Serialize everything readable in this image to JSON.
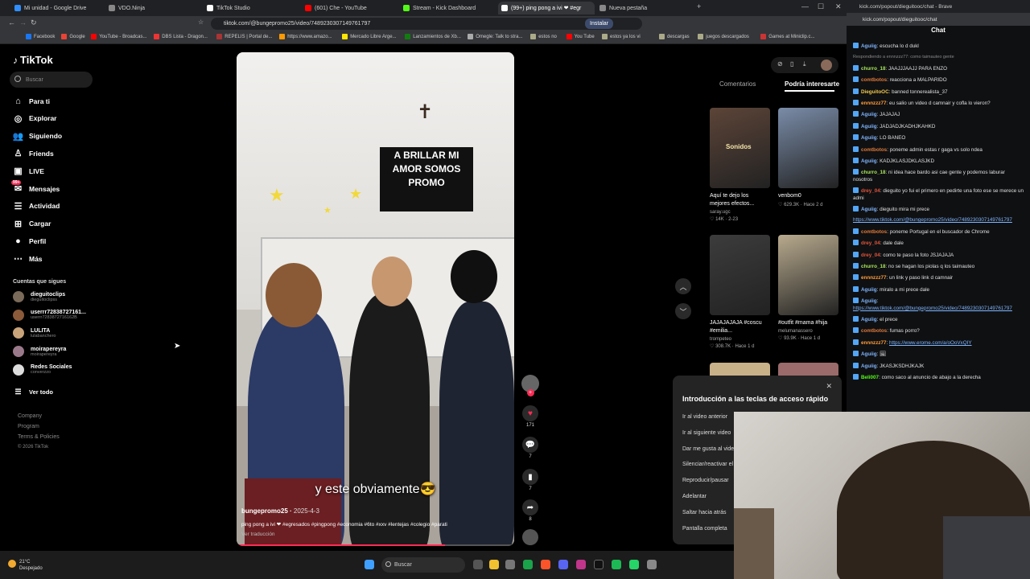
{
  "browser": {
    "tabs": [
      {
        "label": "Mi unidad - Google Drive",
        "color": "#2f8fff"
      },
      {
        "label": "VDO.Ninja",
        "color": "#888888"
      },
      {
        "label": "TikTok Studio",
        "color": "#ffffff"
      },
      {
        "label": "(601) Che - YouTube",
        "color": "#ff0000"
      },
      {
        "label": "Stream - Kick Dashboard",
        "color": "#53fc18"
      },
      {
        "label": "(99+) ping pong a ivi ❤ #egr",
        "color": "#ffffff"
      },
      {
        "label": "Nueva pestaña",
        "color": "#888888"
      }
    ],
    "url": "tiktok.com/@bungepromo25/video/7489230307149761797",
    "install_label": "Instalar",
    "bookmarks": [
      "Facebook",
      "Google",
      "YouTube - Broadcas...",
      "DBS Lista - Dragon...",
      "REPELIS | Portal de...",
      "https://www.amazo...",
      "Mercado Libre Arge...",
      "Lanzamientos de Xb...",
      "Omegle: Talk to stra...",
      "estos no",
      "You Tube",
      "estos ya los vi",
      "descargas",
      "juegos descargados",
      "Games at Miniclip.c..."
    ]
  },
  "tiktok": {
    "logo": "TikTok",
    "search_placeholder": "Buscar",
    "nav": [
      {
        "label": "Para ti",
        "icon": "⌂"
      },
      {
        "label": "Explorar",
        "icon": "◎"
      },
      {
        "label": "Siguiendo",
        "icon": "👥"
      },
      {
        "label": "Friends",
        "icon": "♙"
      },
      {
        "label": "LIVE",
        "icon": "▣"
      },
      {
        "label": "Mensajes",
        "icon": "✉"
      },
      {
        "label": "Actividad",
        "icon": "☰"
      },
      {
        "label": "Cargar",
        "icon": "⊞"
      },
      {
        "label": "Perfil",
        "icon": "●"
      },
      {
        "label": "Más",
        "icon": "⋯"
      }
    ],
    "messages_badge": "99+",
    "following_title": "Cuentas que sigues",
    "following": [
      {
        "name": "dieguitoclips",
        "handle": "dieguitoclipss"
      },
      {
        "name": "userrr72838727161...",
        "handle": "userrr7283872716162B"
      },
      {
        "name": "LULITA",
        "handle": "lulabanchero"
      },
      {
        "name": "moirapereyra",
        "handle": "moirapereyra"
      },
      {
        "name": "Redes Sociales",
        "handle": "converzzo"
      }
    ],
    "see_all": "Ver todo",
    "footer": [
      "Company",
      "Program",
      "Terms & Policies",
      "© 2026 TikTok"
    ]
  },
  "video": {
    "caption": "y este obviamente😎",
    "author": "bungepromo25",
    "date": "2025-4-3",
    "description": "ping pong a ivi ❤ #egresados #pingpong #economia #6to #xxv #lentejas #colegio #parati",
    "translate": "Ver traducción",
    "banner_text": "A BRILLAR MI AMOR SOMOS PROMO",
    "progress": 0.75,
    "actions": [
      {
        "name": "like",
        "icon": "♥",
        "count": "171"
      },
      {
        "name": "comment",
        "icon": "💬",
        "count": "7"
      },
      {
        "name": "save",
        "icon": "▮",
        "count": "7"
      },
      {
        "name": "share",
        "icon": "➦",
        "count": "8"
      }
    ]
  },
  "right_panel": {
    "tab_comments": "Comentarios",
    "tab_interest": "Podría interesarte",
    "cards": [
      {
        "title": "Aquí te dejo los mejores efectos...",
        "author": "saray.ugc",
        "likes": "14K",
        "when": "2-23",
        "color": "#5c4438"
      },
      {
        "title": "venbom0",
        "author": "",
        "likes": "629.3K",
        "when": "Hace 2 d",
        "color": "#7a8ca8"
      },
      {
        "title": "JAJAJAJAJA #coscu #emilia...",
        "author": "trompeteo",
        "likes": "308.7K",
        "when": "Hace 1 d",
        "color": "#3c3c3c"
      },
      {
        "title": "#outfit #mama #hija",
        "author": "melumanassero",
        "likes": "93.9K",
        "when": "Hace 1 d",
        "color": "#b8aa8e"
      }
    ],
    "thumb_label": "Sonidos"
  },
  "shortcuts": {
    "title": "Introducción a las teclas de acceso rápido",
    "items": [
      "Ir al video anterior",
      "Ir al siguiente video",
      "Dar me gusta al video",
      "Silenciar/reactivar el",
      "Reproducir/pausar",
      "Adelantar",
      "Saltar hacia atrás",
      "Pantalla completa"
    ]
  },
  "kick": {
    "window_title": "kick.com/popout/dieguitooc/chat - Brave",
    "url": "kick.com/popout/dieguitooc/chat",
    "header": "Chat",
    "messages": [
      {
        "user": "Aguiig",
        "text": "escucha lo d dukl",
        "color": "#7fb6ff"
      },
      {
        "user": "",
        "text": "Respondiendo a ennnzzz77: como taimauteo gente",
        "color": "#888888"
      },
      {
        "user": "churro_18",
        "text": "JAAJJJAAJJ PARA ENZO",
        "color": "#a6e35a"
      },
      {
        "user": "comtbotos",
        "text": "reacciona a MALPARIDO",
        "color": "#e07a3a"
      },
      {
        "user": "DieguitoOC",
        "text": "banned tonnerealista_37",
        "color": "#f2c94c"
      },
      {
        "user": "ennnzzz77",
        "text": "eu salio un video d camnair y cofla lo vieron?",
        "color": "#ff9d3b"
      },
      {
        "user": "Aguiig",
        "text": "JAJAJAJ",
        "color": "#7fb6ff"
      },
      {
        "user": "Aguiig",
        "text": "JADJADJKADHJKAHKD",
        "color": "#7fb6ff"
      },
      {
        "user": "Aguiig",
        "text": "LO BANEO",
        "color": "#7fb6ff"
      },
      {
        "user": "comtbotos",
        "text": "poneme admin estas r gaga vs solo ndea",
        "color": "#e07a3a"
      },
      {
        "user": "Aguiig",
        "text": "KADJKLASJDKLASJKD",
        "color": "#7fb6ff"
      },
      {
        "user": "churro_18",
        "text": "ni idea hace bardo asi cae gente y podemos laburar nosotros",
        "color": "#a6e35a"
      },
      {
        "user": "drey_04",
        "text": "dieguito yo fui el primero en pedirte una foto ese se merece un admi",
        "color": "#e0553a"
      },
      {
        "user": "Aguiig",
        "text": "dieguito mira mi prece",
        "color": "#7fb6ff"
      },
      {
        "user": "",
        "text": "https://www.tiktok.com/@bungepromo25/video/7489230307149761797",
        "color": "#7fb6ff",
        "link": true
      },
      {
        "user": "comtbotos",
        "text": "poneme Portugal en el buscador de Chrome",
        "color": "#e07a3a"
      },
      {
        "user": "drey_04",
        "text": "dale dale",
        "color": "#e0553a"
      },
      {
        "user": "drey_04",
        "text": "como te paso la foto JSJAJAJA",
        "color": "#e0553a"
      },
      {
        "user": "churro_18",
        "text": "no se hagan los piolas q los taimauteo",
        "color": "#a6e35a"
      },
      {
        "user": "ennnzzz77",
        "text": "un link y paso link d camnair",
        "color": "#ff9d3b"
      },
      {
        "user": "Aguiig",
        "text": "miralo a mi prece dale",
        "color": "#7fb6ff"
      },
      {
        "user": "Aguiig",
        "text": "https://www.tiktok.com/@bungepromo25/video/7489230307149761797",
        "color": "#7fb6ff",
        "link": true
      },
      {
        "user": "Aguiig",
        "text": "el prece",
        "color": "#7fb6ff"
      },
      {
        "user": "comtbotos",
        "text": "fumas porro?",
        "color": "#e07a3a"
      },
      {
        "user": "ennnzzz77",
        "text": "https://www.erome.com/a/oOoVxQIY",
        "color": "#ff9d3b",
        "link": true
      },
      {
        "user": "Aguiig",
        "text": "🖼",
        "color": "#7fb6ff"
      },
      {
        "user": "Aguiig",
        "text": "JKASJKSDHJKAJK",
        "color": "#7fb6ff"
      },
      {
        "user": "Beli007",
        "text": "como saco al anuncio de abajo a la derecha",
        "color": "#53fc18"
      }
    ]
  },
  "taskbar": {
    "temp": "21°C",
    "weather": "Despejado",
    "search": "Buscar"
  }
}
